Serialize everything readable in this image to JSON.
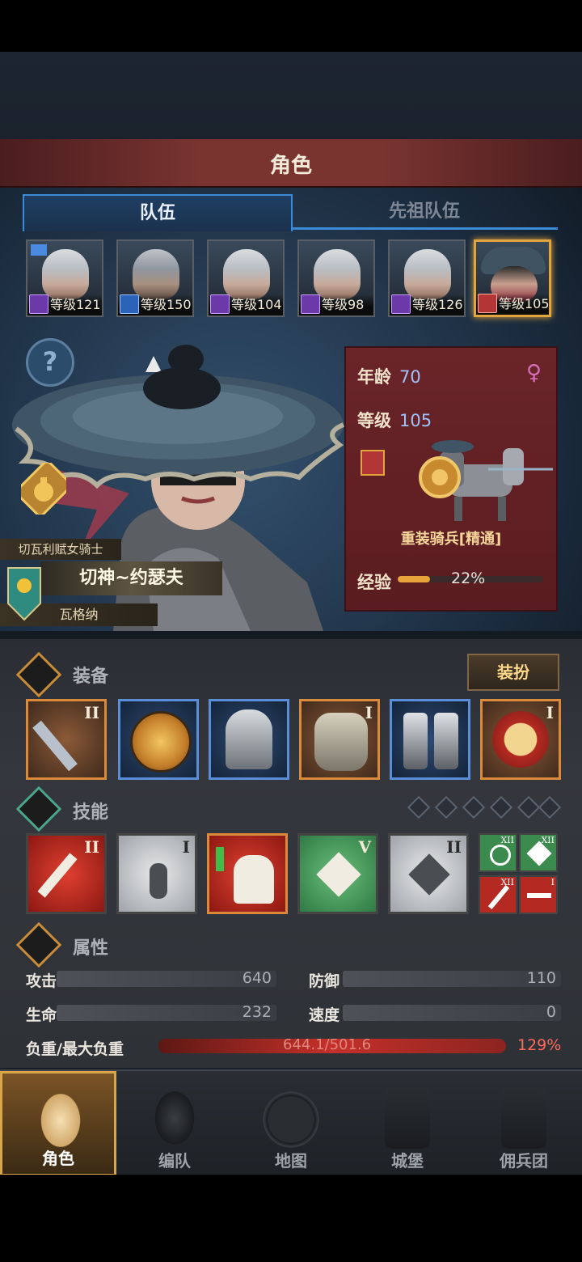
{
  "title": "角色",
  "tabs": [
    {
      "label": "队伍"
    },
    {
      "label": "先祖队伍"
    }
  ],
  "roster": [
    {
      "level_text": "等级121",
      "class": "purple"
    },
    {
      "level_text": "等级150",
      "class": "blue"
    },
    {
      "level_text": "等级104",
      "class": "purple"
    },
    {
      "level_text": "等级98",
      "class": "purple"
    },
    {
      "level_text": "等级126",
      "class": "purple"
    },
    {
      "level_text": "等级105",
      "class": "red",
      "selected": true
    }
  ],
  "character": {
    "subtitle": "切瓦利赋女骑士",
    "name": "切神~约瑟夫",
    "origin": "瓦格纳",
    "help_icon": "?"
  },
  "info": {
    "age_label": "年龄",
    "age_value": "70",
    "level_label": "等级",
    "level_value": "105",
    "gender_icon": "♀",
    "unit_name": "重装骑兵[精通]",
    "exp_label": "经验",
    "exp_pct_text": "22%",
    "exp_fraction": 0.22
  },
  "equipment": {
    "section_title": "装备",
    "button_label": "装扮",
    "slots": [
      {
        "roman": "II",
        "icon": "sword-icon"
      },
      {
        "roman": "",
        "icon": "round-shield-icon"
      },
      {
        "roman": "",
        "icon": "helmet-icon"
      },
      {
        "roman": "I",
        "icon": "armor-icon"
      },
      {
        "roman": "",
        "icon": "boots-icon"
      },
      {
        "roman": "I",
        "icon": "medal-icon"
      }
    ]
  },
  "skills": {
    "section_title": "技能",
    "slots": [
      {
        "roman": "II",
        "icon": "broken-sword-skill-icon"
      },
      {
        "roman": "I",
        "icon": "meditation-skill-icon"
      },
      {
        "roman": "",
        "icon": "horse-charge-skill-icon"
      },
      {
        "roman": "V",
        "icon": "crystal-burst-skill-icon"
      },
      {
        "roman": "II",
        "icon": "crystal-shield-skill-icon"
      }
    ],
    "mini": [
      {
        "roman": "XII",
        "icon": "target-skill-icon"
      },
      {
        "roman": "XII",
        "icon": "burst-skill-icon"
      },
      {
        "roman": "XII",
        "icon": "sword-down-skill-icon"
      },
      {
        "roman": "I",
        "icon": "dumbbell-skill-icon"
      }
    ]
  },
  "attributes": {
    "section_title": "属性",
    "attack_label": "攻击",
    "attack_value": "640",
    "defense_label": "防御",
    "defense_value": "110",
    "hp_label": "生命",
    "hp_value": "232",
    "speed_label": "速度",
    "speed_value": "0",
    "load_label": "负重/最大负重",
    "load_value": "644.1/501.6",
    "load_pct": "129%"
  },
  "nav": [
    {
      "label": "角色",
      "icon": "knight-icon",
      "active": true
    },
    {
      "label": "编队",
      "icon": "helmet-formation-icon"
    },
    {
      "label": "地图",
      "icon": "compass-map-icon"
    },
    {
      "label": "城堡",
      "icon": "castle-icon"
    },
    {
      "label": "佣兵团",
      "icon": "mercenary-icon"
    }
  ]
}
